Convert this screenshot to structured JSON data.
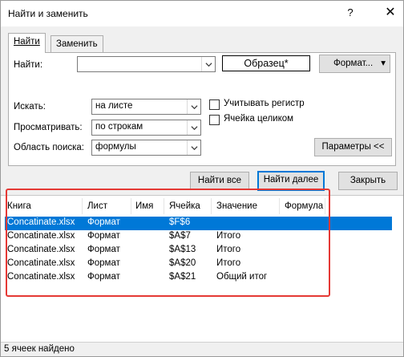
{
  "window": {
    "title": "Найти и заменить",
    "help_glyph": "?",
    "close_glyph": "✕"
  },
  "tabs": [
    {
      "label": "Найти",
      "active": true
    },
    {
      "label": "Заменить",
      "active": false
    }
  ],
  "find": {
    "label": "Найти:",
    "value": "",
    "preview": "Образец*",
    "format_button": "Формат...",
    "format_arrow": "▾"
  },
  "options": {
    "within": {
      "label": "Искать:",
      "value": "на листе"
    },
    "search": {
      "label": "Просматривать:",
      "value": "по строкам"
    },
    "look_in": {
      "label": "Область поиска:",
      "value": "формулы"
    },
    "match_case": {
      "label": "Учитывать регистр",
      "checked": false
    },
    "entire_cell": {
      "label": "Ячейка целиком",
      "checked": false
    },
    "options_button": "Параметры <<"
  },
  "actions": {
    "find_all": "Найти все",
    "find_next": "Найти далее",
    "close": "Закрыть"
  },
  "results": {
    "columns": [
      "Книга",
      "Лист",
      "Имя",
      "Ячейка",
      "Значение",
      "Формула"
    ],
    "rows": [
      {
        "book": "Concatinate.xlsx",
        "sheet": "Формат",
        "name": "",
        "cell": "$F$6",
        "value": "",
        "formula": "",
        "selected": true
      },
      {
        "book": "Concatinate.xlsx",
        "sheet": "Формат",
        "name": "",
        "cell": "$A$7",
        "value": "Итого",
        "formula": "",
        "selected": false
      },
      {
        "book": "Concatinate.xlsx",
        "sheet": "Формат",
        "name": "",
        "cell": "$A$13",
        "value": "Итого",
        "formula": "",
        "selected": false
      },
      {
        "book": "Concatinate.xlsx",
        "sheet": "Формат",
        "name": "",
        "cell": "$A$20",
        "value": "Итого",
        "formula": "",
        "selected": false
      },
      {
        "book": "Concatinate.xlsx",
        "sheet": "Формат",
        "name": "",
        "cell": "$A$21",
        "value": "Общий итог",
        "formula": "",
        "selected": false
      }
    ]
  },
  "status": "5 ячеек найдено",
  "colors": {
    "accent": "#0078d7",
    "highlight_frame": "#e53935"
  }
}
